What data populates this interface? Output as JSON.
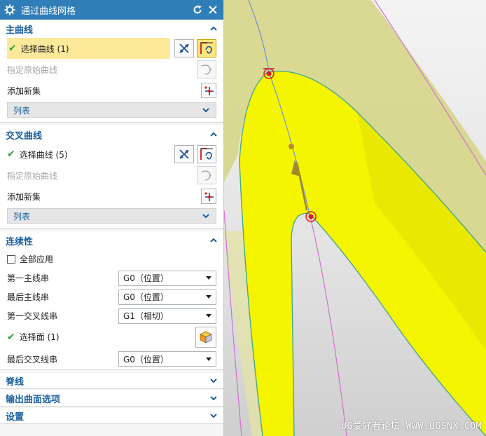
{
  "dialog": {
    "title": "通过曲线网格",
    "icons": {
      "app": "gear-icon",
      "reset": "reset-icon",
      "close": "close-icon"
    }
  },
  "primary": {
    "header": "主曲线",
    "select_curve": "选择曲线 (1)",
    "specify_origin": "指定原始曲线",
    "add_new_set": "添加新集",
    "list": "列表"
  },
  "cross": {
    "header": "交叉曲线",
    "select_curve": "选择曲线 (5)",
    "specify_origin": "指定原始曲线",
    "add_new_set": "添加新集",
    "list": "列表"
  },
  "continuity": {
    "header": "连续性",
    "apply_all": "全部应用",
    "apply_all_checked": false,
    "fields": [
      {
        "label": "第一主线串",
        "value": "G0（位置）"
      },
      {
        "label": "最后主线串",
        "value": "G0（位置）"
      },
      {
        "label": "第一交叉线串",
        "value": "G1（相切）"
      }
    ],
    "select_face": "选择面 (1)",
    "last_cross": {
      "label": "最后交叉线串",
      "value": "G0（位置）"
    }
  },
  "collapsed": {
    "spine": "脊线",
    "output_options": "输出曲面选项",
    "settings": "设置"
  },
  "viewport": {
    "watermark": "UG爱好者论坛 WWW.UGSNX.COM",
    "colors": {
      "surface": "#f5f500",
      "back_surface": "#d6d68a",
      "edge": "#4aa88a",
      "curve": "#d070d0",
      "marker": "#d82020"
    }
  }
}
